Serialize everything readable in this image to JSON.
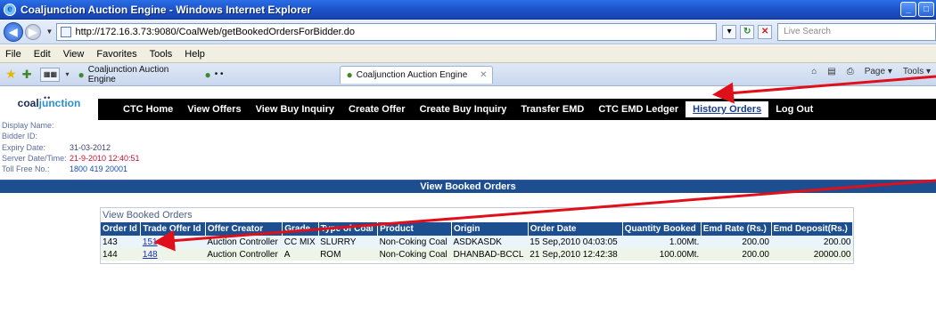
{
  "window": {
    "title": "Coaljunction Auction Engine - Windows Internet Explorer"
  },
  "address": {
    "url": "http://172.16.3.73:9080/CoalWeb/getBookedOrdersForBidder.do",
    "search_placeholder": "Live Search"
  },
  "menu": [
    "File",
    "Edit",
    "View",
    "Favorites",
    "Tools",
    "Help"
  ],
  "tabs": [
    {
      "label": "Coaljunction Auction Engine"
    },
    {
      "label": "• •"
    },
    {
      "label": "Coaljunction Auction Engine"
    }
  ],
  "toolbar_right": {
    "page": "Page ▾",
    "tools": "Tools ▾"
  },
  "logo": {
    "part1": "coal",
    "part2": "junction"
  },
  "nav": [
    "CTC Home",
    "View Offers",
    "View Buy Inquiry",
    "Create Offer",
    "Create Buy Inquiry",
    "Transfer EMD",
    "CTC EMD Ledger",
    "History Orders",
    "Log Out"
  ],
  "nav_selected": "History Orders",
  "info": [
    {
      "label": "Display Name:",
      "value": ""
    },
    {
      "label": "Bidder ID:",
      "value": ""
    },
    {
      "label": "Expiry Date:",
      "value": "31-03-2012"
    },
    {
      "label": "Server Date/Time:",
      "value": "21-9-2010 12:40:51"
    },
    {
      "label": "Toll Free No.:",
      "value": "1800 419 20001"
    }
  ],
  "band_title": "View Booked Orders",
  "orders": {
    "caption": "View Booked Orders",
    "headers": [
      "Order Id",
      "Trade Offer Id",
      "Offer Creator",
      "Grade",
      "Type of Coal",
      "Product",
      "Origin",
      "Order Date",
      "Quantity Booked",
      "Emd Rate (Rs.)",
      "Emd Deposit(Rs.)"
    ],
    "rows": [
      [
        "143",
        "151",
        "Auction Controller",
        "CC MIX",
        "SLURRY",
        "Non-Coking Coal",
        "ASDKASDK",
        "15 Sep,2010 04:03:05",
        "1.00Mt.",
        "200.00",
        "200.00"
      ],
      [
        "144",
        "148",
        "Auction Controller",
        "A",
        "ROM",
        "Non-Coking Coal",
        "DHANBAD-BCCL",
        "21 Sep,2010 12:42:38",
        "100.00Mt.",
        "200.00",
        "20000.00"
      ]
    ]
  },
  "colors": {
    "navbar": "#000000",
    "band": "#1d4e8f",
    "accent_red": "#e0101a",
    "link": "#1a2fb5"
  }
}
